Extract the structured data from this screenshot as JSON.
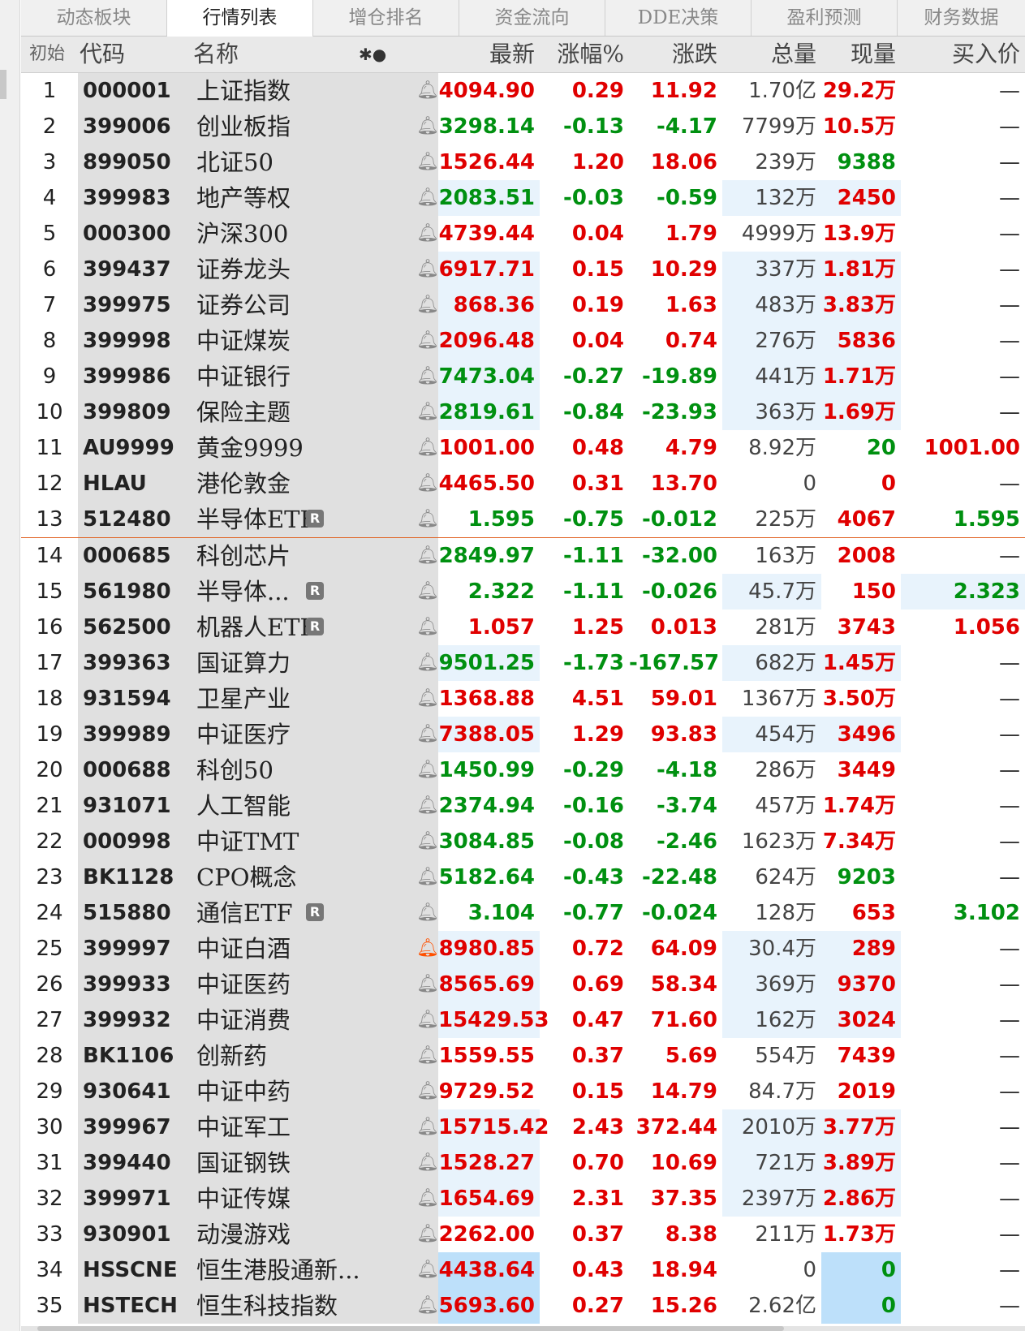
{
  "tabs": [
    {
      "label": "动态板块",
      "active": false
    },
    {
      "label": "行情列表",
      "active": true
    },
    {
      "label": "增仓排名",
      "active": false
    },
    {
      "label": "资金流向",
      "active": false
    },
    {
      "label": "DDE决策",
      "active": false
    },
    {
      "label": "盈利预测",
      "active": false
    },
    {
      "label": "财务数据",
      "active": false
    }
  ],
  "header": {
    "initial": "初始",
    "code": "代码",
    "name": "名称",
    "icons": "✱●",
    "latest": "最新",
    "change_pct": "涨幅%",
    "change": "涨跌",
    "volume": "总量",
    "current_volume": "现量",
    "bid_price": "买入价"
  },
  "colors": {
    "up": "#e00000",
    "down": "#009010",
    "neutral": "#444444",
    "highlight": "#e8f3fc",
    "highlight_strong": "#bde0fa",
    "alert": "#ff5000",
    "separator": "#e06020"
  },
  "rows": [
    {
      "idx": "1",
      "code": "000001",
      "name": "上证指数",
      "r": false,
      "alert": false,
      "latest": "4094.90",
      "pct": "0.29",
      "chg": "11.92",
      "vol": "1.70亿",
      "cur": "29.2万",
      "bid": "—",
      "dir": "up",
      "cur_dir": "up",
      "hl": "",
      "hlv": "",
      "hlb": ""
    },
    {
      "idx": "2",
      "code": "399006",
      "name": "创业板指",
      "r": false,
      "alert": false,
      "latest": "3298.14",
      "pct": "-0.13",
      "chg": "-4.17",
      "vol": "7799万",
      "cur": "10.5万",
      "bid": "—",
      "dir": "down",
      "cur_dir": "up",
      "hl": "",
      "hlv": "",
      "hlb": ""
    },
    {
      "idx": "3",
      "code": "899050",
      "name": "北证50",
      "r": false,
      "alert": false,
      "latest": "1526.44",
      "pct": "1.20",
      "chg": "18.06",
      "vol": "239万",
      "cur": "9388",
      "bid": "—",
      "dir": "up",
      "cur_dir": "down",
      "hl": "",
      "hlv": "",
      "hlb": ""
    },
    {
      "idx": "4",
      "code": "399983",
      "name": "地产等权",
      "r": false,
      "alert": false,
      "latest": "2083.51",
      "pct": "-0.03",
      "chg": "-0.59",
      "vol": "132万",
      "cur": "2450",
      "bid": "—",
      "dir": "down",
      "cur_dir": "up",
      "hl": "hl",
      "hlv": "hl",
      "hlb": ""
    },
    {
      "idx": "5",
      "code": "000300",
      "name": "沪深300",
      "r": false,
      "alert": false,
      "latest": "4739.44",
      "pct": "0.04",
      "chg": "1.79",
      "vol": "4999万",
      "cur": "13.9万",
      "bid": "—",
      "dir": "up",
      "cur_dir": "up",
      "hl": "",
      "hlv": "",
      "hlb": ""
    },
    {
      "idx": "6",
      "code": "399437",
      "name": "证券龙头",
      "r": false,
      "alert": false,
      "latest": "6917.71",
      "pct": "0.15",
      "chg": "10.29",
      "vol": "337万",
      "cur": "1.81万",
      "bid": "—",
      "dir": "up",
      "cur_dir": "up",
      "hl": "hl",
      "hlv": "hl",
      "hlb": ""
    },
    {
      "idx": "7",
      "code": "399975",
      "name": "证券公司",
      "r": false,
      "alert": false,
      "latest": "868.36",
      "pct": "0.19",
      "chg": "1.63",
      "vol": "483万",
      "cur": "3.83万",
      "bid": "—",
      "dir": "up",
      "cur_dir": "up",
      "hl": "hl",
      "hlv": "hl",
      "hlb": ""
    },
    {
      "idx": "8",
      "code": "399998",
      "name": "中证煤炭",
      "r": false,
      "alert": false,
      "latest": "2096.48",
      "pct": "0.04",
      "chg": "0.74",
      "vol": "276万",
      "cur": "5836",
      "bid": "—",
      "dir": "up",
      "cur_dir": "up",
      "hl": "hl",
      "hlv": "hl",
      "hlb": ""
    },
    {
      "idx": "9",
      "code": "399986",
      "name": "中证银行",
      "r": false,
      "alert": false,
      "latest": "7473.04",
      "pct": "-0.27",
      "chg": "-19.89",
      "vol": "441万",
      "cur": "1.71万",
      "bid": "—",
      "dir": "down",
      "cur_dir": "up",
      "hl": "hl",
      "hlv": "hl",
      "hlb": ""
    },
    {
      "idx": "10",
      "code": "399809",
      "name": "保险主题",
      "r": false,
      "alert": false,
      "latest": "2819.61",
      "pct": "-0.84",
      "chg": "-23.93",
      "vol": "363万",
      "cur": "1.69万",
      "bid": "—",
      "dir": "down",
      "cur_dir": "up",
      "hl": "hl",
      "hlv": "hl",
      "hlb": ""
    },
    {
      "idx": "11",
      "code": "AU9999",
      "name": "黄金9999",
      "r": false,
      "alert": false,
      "latest": "1001.00",
      "pct": "0.48",
      "chg": "4.79",
      "vol": "8.92万",
      "cur": "20",
      "bid": "1001.00",
      "dir": "up",
      "cur_dir": "down",
      "bid_dir": "up",
      "hl": "",
      "hlv": "",
      "hlb": ""
    },
    {
      "idx": "12",
      "code": "HLAU",
      "name": "港伦敦金",
      "r": false,
      "alert": false,
      "latest": "4465.50",
      "pct": "0.31",
      "chg": "13.70",
      "vol": "0",
      "cur": "0",
      "bid": "—",
      "dir": "up",
      "cur_dir": "up",
      "hl": "",
      "hlv": "",
      "hlb": ""
    },
    {
      "idx": "13",
      "code": "512480",
      "name": "半导体ETF",
      "r": true,
      "alert": false,
      "latest": "1.595",
      "pct": "-0.75",
      "chg": "-0.012",
      "vol": "225万",
      "cur": "4067",
      "bid": "1.595",
      "dir": "down",
      "cur_dir": "up",
      "bid_dir": "down",
      "hl": "",
      "hlv": "",
      "hlb": ""
    },
    {
      "idx": "14",
      "code": "000685",
      "name": "科创芯片",
      "r": false,
      "alert": false,
      "latest": "2849.97",
      "pct": "-1.11",
      "chg": "-32.00",
      "vol": "163万",
      "cur": "2008",
      "bid": "—",
      "dir": "down",
      "cur_dir": "up",
      "hl": "",
      "hlv": "",
      "hlb": "",
      "sep": true
    },
    {
      "idx": "15",
      "code": "561980",
      "name": "半导体...",
      "r": true,
      "alert": false,
      "latest": "2.322",
      "pct": "-1.11",
      "chg": "-0.026",
      "vol": "45.7万",
      "cur": "150",
      "bid": "2.323",
      "dir": "down",
      "cur_dir": "up",
      "bid_dir": "down",
      "hl": "",
      "hlv": "hlvol",
      "hlb": "hl"
    },
    {
      "idx": "16",
      "code": "562500",
      "name": "机器人ETF",
      "r": true,
      "alert": false,
      "latest": "1.057",
      "pct": "1.25",
      "chg": "0.013",
      "vol": "281万",
      "cur": "3743",
      "bid": "1.056",
      "dir": "up",
      "cur_dir": "up",
      "bid_dir": "up",
      "hl": "",
      "hlv": "",
      "hlb": ""
    },
    {
      "idx": "17",
      "code": "399363",
      "name": "国证算力",
      "r": false,
      "alert": false,
      "latest": "9501.25",
      "pct": "-1.73",
      "chg": "-167.57",
      "vol": "682万",
      "cur": "1.45万",
      "bid": "—",
      "dir": "down",
      "cur_dir": "up",
      "hl": "hl",
      "hlv": "hl",
      "hlb": ""
    },
    {
      "idx": "18",
      "code": "931594",
      "name": "卫星产业",
      "r": false,
      "alert": false,
      "latest": "1368.88",
      "pct": "4.51",
      "chg": "59.01",
      "vol": "1367万",
      "cur": "3.50万",
      "bid": "—",
      "dir": "up",
      "cur_dir": "up",
      "hl": "",
      "hlv": "",
      "hlb": ""
    },
    {
      "idx": "19",
      "code": "399989",
      "name": "中证医疗",
      "r": false,
      "alert": false,
      "latest": "7388.05",
      "pct": "1.29",
      "chg": "93.83",
      "vol": "454万",
      "cur": "3496",
      "bid": "—",
      "dir": "up",
      "cur_dir": "up",
      "hl": "hl",
      "hlv": "hl",
      "hlb": ""
    },
    {
      "idx": "20",
      "code": "000688",
      "name": "科创50",
      "r": false,
      "alert": false,
      "latest": "1450.99",
      "pct": "-0.29",
      "chg": "-4.18",
      "vol": "286万",
      "cur": "3449",
      "bid": "—",
      "dir": "down",
      "cur_dir": "up",
      "hl": "",
      "hlv": "",
      "hlb": ""
    },
    {
      "idx": "21",
      "code": "931071",
      "name": "人工智能",
      "r": false,
      "alert": false,
      "latest": "2374.94",
      "pct": "-0.16",
      "chg": "-3.74",
      "vol": "457万",
      "cur": "1.74万",
      "bid": "—",
      "dir": "down",
      "cur_dir": "up",
      "hl": "",
      "hlv": "",
      "hlb": ""
    },
    {
      "idx": "22",
      "code": "000998",
      "name": "中证TMT",
      "r": false,
      "alert": false,
      "latest": "3084.85",
      "pct": "-0.08",
      "chg": "-2.46",
      "vol": "1623万",
      "cur": "7.34万",
      "bid": "—",
      "dir": "down",
      "cur_dir": "up",
      "hl": "",
      "hlv": "",
      "hlb": ""
    },
    {
      "idx": "23",
      "code": "BK1128",
      "name": "CPO概念",
      "r": false,
      "alert": false,
      "latest": "5182.64",
      "pct": "-0.43",
      "chg": "-22.48",
      "vol": "624万",
      "cur": "9203",
      "bid": "—",
      "dir": "down",
      "cur_dir": "down",
      "hl": "",
      "hlv": "",
      "hlb": ""
    },
    {
      "idx": "24",
      "code": "515880",
      "name": "通信ETF",
      "r": true,
      "alert": false,
      "latest": "3.104",
      "pct": "-0.77",
      "chg": "-0.024",
      "vol": "128万",
      "cur": "653",
      "bid": "3.102",
      "dir": "down",
      "cur_dir": "up",
      "bid_dir": "down",
      "hl": "",
      "hlv": "",
      "hlb": "",
      "rpos": "far"
    },
    {
      "idx": "25",
      "code": "399997",
      "name": "中证白酒",
      "r": false,
      "alert": true,
      "latest": "8980.85",
      "pct": "0.72",
      "chg": "64.09",
      "vol": "30.4万",
      "cur": "289",
      "bid": "—",
      "dir": "up",
      "cur_dir": "up",
      "hl": "hl",
      "hlv": "hl",
      "hlb": ""
    },
    {
      "idx": "26",
      "code": "399933",
      "name": "中证医药",
      "r": false,
      "alert": false,
      "latest": "8565.69",
      "pct": "0.69",
      "chg": "58.34",
      "vol": "369万",
      "cur": "9370",
      "bid": "—",
      "dir": "up",
      "cur_dir": "up",
      "hl": "hl",
      "hlv": "hl",
      "hlb": ""
    },
    {
      "idx": "27",
      "code": "399932",
      "name": "中证消费",
      "r": false,
      "alert": false,
      "latest": "15429.53",
      "pct": "0.47",
      "chg": "71.60",
      "vol": "162万",
      "cur": "3024",
      "bid": "—",
      "dir": "up",
      "cur_dir": "up",
      "hl": "hl",
      "hlv": "hl",
      "hlb": ""
    },
    {
      "idx": "28",
      "code": "BK1106",
      "name": "创新药",
      "r": false,
      "alert": false,
      "latest": "1559.55",
      "pct": "0.37",
      "chg": "5.69",
      "vol": "554万",
      "cur": "7439",
      "bid": "—",
      "dir": "up",
      "cur_dir": "up",
      "hl": "",
      "hlv": "",
      "hlb": ""
    },
    {
      "idx": "29",
      "code": "930641",
      "name": "中证中药",
      "r": false,
      "alert": false,
      "latest": "9729.52",
      "pct": "0.15",
      "chg": "14.79",
      "vol": "84.7万",
      "cur": "2019",
      "bid": "—",
      "dir": "up",
      "cur_dir": "up",
      "hl": "",
      "hlv": "",
      "hlb": ""
    },
    {
      "idx": "30",
      "code": "399967",
      "name": "中证军工",
      "r": false,
      "alert": false,
      "latest": "15715.42",
      "pct": "2.43",
      "chg": "372.44",
      "vol": "2010万",
      "cur": "3.77万",
      "bid": "—",
      "dir": "up",
      "cur_dir": "up",
      "hl": "hl",
      "hlv": "hl",
      "hlb": ""
    },
    {
      "idx": "31",
      "code": "399440",
      "name": "国证钢铁",
      "r": false,
      "alert": false,
      "latest": "1528.27",
      "pct": "0.70",
      "chg": "10.69",
      "vol": "721万",
      "cur": "3.89万",
      "bid": "—",
      "dir": "up",
      "cur_dir": "up",
      "hl": "hl",
      "hlv": "hl",
      "hlb": ""
    },
    {
      "idx": "32",
      "code": "399971",
      "name": "中证传媒",
      "r": false,
      "alert": false,
      "latest": "1654.69",
      "pct": "2.31",
      "chg": "37.35",
      "vol": "2397万",
      "cur": "2.86万",
      "bid": "—",
      "dir": "up",
      "cur_dir": "up",
      "hl": "hl",
      "hlv": "hl",
      "hlb": ""
    },
    {
      "idx": "33",
      "code": "930901",
      "name": "动漫游戏",
      "r": false,
      "alert": false,
      "latest": "2262.00",
      "pct": "0.37",
      "chg": "8.38",
      "vol": "211万",
      "cur": "1.73万",
      "bid": "—",
      "dir": "up",
      "cur_dir": "up",
      "hl": "",
      "hlv": "",
      "hlb": ""
    },
    {
      "idx": "34",
      "code": "HSSCNE",
      "name": "恒生港股通新...",
      "r": false,
      "alert": false,
      "latest": "4438.64",
      "pct": "0.43",
      "chg": "18.94",
      "vol": "0",
      "cur": "0",
      "bid": "—",
      "dir": "up",
      "cur_dir": "down",
      "hl": "hl2",
      "hlv": "",
      "hlcur": "hl2",
      "hlb": ""
    },
    {
      "idx": "35",
      "code": "HSTECH",
      "name": "恒生科技指数",
      "r": false,
      "alert": false,
      "latest": "5693.60",
      "pct": "0.27",
      "chg": "15.26",
      "vol": "2.62亿",
      "cur": "0",
      "bid": "—",
      "dir": "up",
      "cur_dir": "down",
      "hl": "hl2",
      "hlv": "",
      "hlcur": "hl2",
      "hlb": ""
    }
  ]
}
